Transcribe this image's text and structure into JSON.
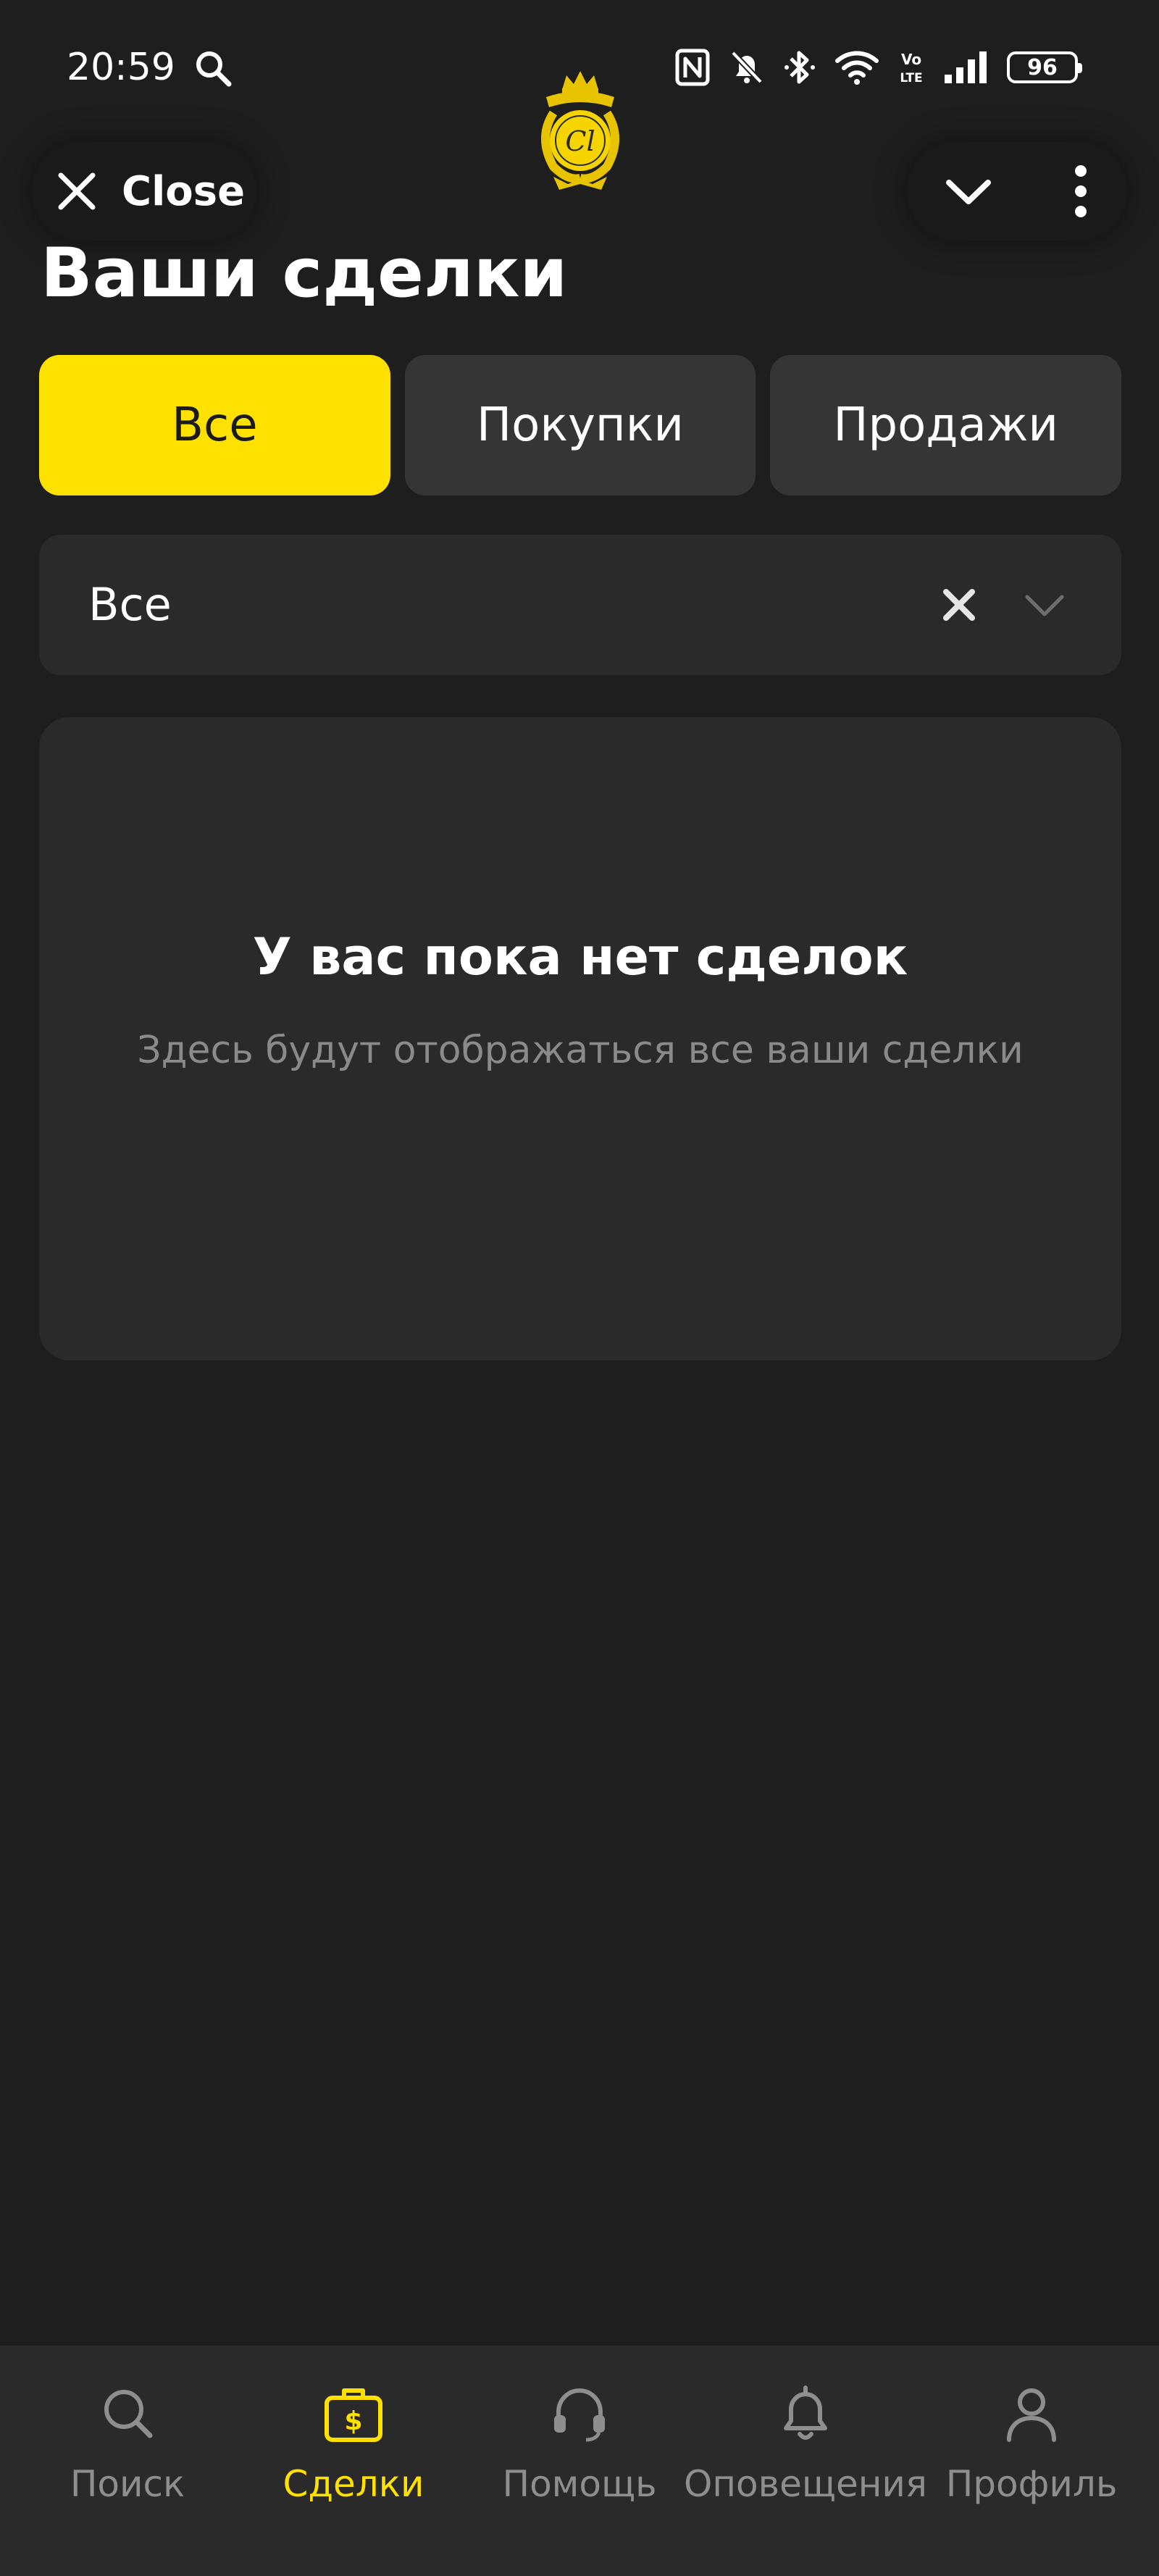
{
  "status_bar": {
    "time": "20:59",
    "battery": "96",
    "icons": [
      "search-icon",
      "nfc-icon",
      "bell-off-icon",
      "bluetooth-icon",
      "wifi-icon",
      "volte-icon",
      "signal-icon",
      "battery-icon"
    ]
  },
  "header": {
    "close_label": "Close",
    "logo_icon": "crest-logo"
  },
  "page": {
    "title": "Ваши сделки"
  },
  "tabs": [
    {
      "label": "Все",
      "active": true
    },
    {
      "label": "Покупки",
      "active": false
    },
    {
      "label": "Продажи",
      "active": false
    }
  ],
  "filter": {
    "value": "Все"
  },
  "empty_state": {
    "title": "У вас пока нет сделок",
    "subtitle": "Здесь будут отображаться все ваши сделки"
  },
  "bottom_nav": [
    {
      "label": "Поиск",
      "icon": "search-icon",
      "active": false
    },
    {
      "label": "Сделки",
      "icon": "briefcase-dollar-icon",
      "active": true
    },
    {
      "label": "Помощь",
      "icon": "headset-icon",
      "active": false
    },
    {
      "label": "Оповещения",
      "icon": "bell-icon",
      "active": false
    },
    {
      "label": "Профиль",
      "icon": "user-icon",
      "active": false
    }
  ],
  "colors": {
    "background": "#1e1e1e",
    "card": "#2a2a2a",
    "accent": "#ffe100",
    "muted_text": "#8a8a8a"
  }
}
